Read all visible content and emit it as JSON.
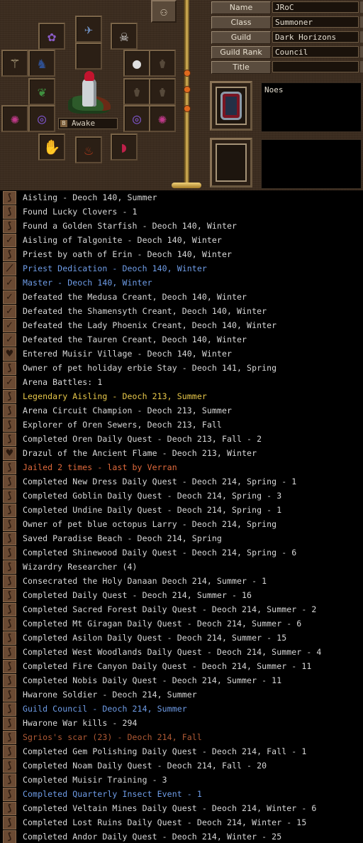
{
  "profile": {
    "fields": [
      {
        "label": "Name",
        "value": "JRoC"
      },
      {
        "label": "Class",
        "value": "Summoner"
      },
      {
        "label": "Guild",
        "value": "Dark Horizons"
      },
      {
        "label": "Guild Rank",
        "value": "Council"
      },
      {
        "label": "Title",
        "value": ""
      }
    ],
    "note_1": "Noes",
    "note_2": "",
    "status": "Awake",
    "status_number": "B"
  },
  "colors": {
    "default": "#d9d9d9",
    "blue": "#6f9de8",
    "yellow": "#e8c84a",
    "orange": "#e06a3c",
    "muted": "#b05a35"
  },
  "equipment": {
    "slots": [
      {
        "name": "earring-left-slot",
        "icon": "purple-earring-icon",
        "glyph": "✿",
        "color": "#8b5cc8"
      },
      {
        "name": "necklace-slot",
        "icon": "blue-wing-icon",
        "glyph": "✈",
        "color": "#6f8fbf"
      },
      {
        "name": "ring-right-slot",
        "icon": "skull-charm-icon",
        "glyph": "☠",
        "color": "#e0e0e0"
      },
      {
        "name": "weapon-slot",
        "icon": "staff-icon",
        "glyph": "⚚",
        "color": "#d4c49a"
      },
      {
        "name": "armor-slot",
        "icon": "blue-robe-icon",
        "glyph": "♞",
        "color": "#2f4f8f"
      },
      {
        "name": "helmet-slot",
        "icon": "empty-icon",
        "glyph": "",
        "color": "#000"
      },
      {
        "name": "overcoat-slot",
        "icon": "ghost-item-icon",
        "glyph": "⚱",
        "color": "#a89880"
      },
      {
        "name": "accessory-1-slot",
        "icon": "black-pouch-icon",
        "glyph": "●",
        "color": "#e0e0e0"
      },
      {
        "name": "accessory-2-slot",
        "icon": "ghost-item-icon",
        "glyph": "⚱",
        "color": "#a89880"
      },
      {
        "name": "cape-slot",
        "icon": "green-leaf-icon",
        "glyph": "❦",
        "color": "#3f8f3f"
      },
      {
        "name": "shield-slot",
        "icon": "ghost-item-icon",
        "glyph": "⚱",
        "color": "#a89880"
      },
      {
        "name": "gauntlet-slot",
        "icon": "ghost-item-icon",
        "glyph": "⚱",
        "color": "#a89880"
      },
      {
        "name": "hand-left-slot",
        "icon": "pink-claw-icon",
        "glyph": "✺",
        "color": "#c03a8a"
      },
      {
        "name": "bracer-left-slot",
        "icon": "purple-ring-icon",
        "glyph": "◎",
        "color": "#7b53c6"
      },
      {
        "name": "bracer-right-slot",
        "icon": "purple-ring-icon",
        "glyph": "◎",
        "color": "#7b53c6"
      },
      {
        "name": "hand-right-slot",
        "icon": "pink-claw-icon",
        "glyph": "✺",
        "color": "#c03a8a"
      },
      {
        "name": "belt-slot",
        "icon": "silver-gauntlet-icon",
        "glyph": "✋",
        "color": "#c8c8d0"
      },
      {
        "name": "boots-slot",
        "icon": "red-boots-icon",
        "glyph": "♨",
        "color": "#b03a1a"
      },
      {
        "name": "trinket-slot",
        "icon": "magenta-fan-icon",
        "glyph": "◗",
        "color": "#c0204a"
      }
    ]
  },
  "legend": [
    {
      "text": "Aisling - Deoch 140, Summer",
      "color": "default",
      "icon": "claw"
    },
    {
      "text": "Found Lucky Clovers - 1",
      "color": "default",
      "icon": "claw"
    },
    {
      "text": "Found a Golden Starfish - Deoch 140, Winter",
      "color": "default",
      "icon": "claw"
    },
    {
      "text": "Aisling of Talgonite - Deoch 140, Winter",
      "color": "default",
      "icon": "check"
    },
    {
      "text": "Priest by oath of Erin - Deoch 140, Winter",
      "color": "default",
      "icon": "claw"
    },
    {
      "text": "Priest Dedication - Deoch 140, Winter",
      "color": "blue",
      "icon": "wand"
    },
    {
      "text": "Master - Deoch 140, Winter",
      "color": "blue",
      "icon": "check"
    },
    {
      "text": "Defeated the Medusa Creant, Deoch 140, Winter",
      "color": "default",
      "icon": "check"
    },
    {
      "text": "Defeated the Shamensyth Creant, Deoch 140, Winter",
      "color": "default",
      "icon": "check"
    },
    {
      "text": "Defeated the Lady Phoenix Creant, Deoch 140, Winter",
      "color": "default",
      "icon": "check"
    },
    {
      "text": "Defeated the Tauren Creant, Deoch 140, Winter",
      "color": "default",
      "icon": "check"
    },
    {
      "text": "Entered Muisir Village - Deoch 140, Winter",
      "color": "default",
      "icon": "heart"
    },
    {
      "text": "Owner of pet holiday erbie Stay - Deoch 141, Spring",
      "color": "default",
      "icon": "claw"
    },
    {
      "text": "Arena Battles: 1",
      "color": "default",
      "icon": "check"
    },
    {
      "text": "Legendary Aisling - Deoch 213, Summer",
      "color": "yellow",
      "icon": "claw"
    },
    {
      "text": "Arena Circuit Champion - Deoch 213, Summer",
      "color": "default",
      "icon": "claw"
    },
    {
      "text": "Explorer of Oren Sewers, Deoch 213, Fall",
      "color": "default",
      "icon": "claw"
    },
    {
      "text": "Completed Oren Daily Quest - Deoch 213, Fall - 2",
      "color": "default",
      "icon": "claw"
    },
    {
      "text": "Drazul of the Ancient Flame - Deoch 213, Winter",
      "color": "default",
      "icon": "heart"
    },
    {
      "text": "Jailed 2 times - last by Verran",
      "color": "orange",
      "icon": "claw"
    },
    {
      "text": "Completed New Dress Daily Quest - Deoch 214, Spring - 1",
      "color": "default",
      "icon": "claw"
    },
    {
      "text": "Completed Goblin Daily Quest - Deoch 214, Spring - 3",
      "color": "default",
      "icon": "claw"
    },
    {
      "text": "Completed Undine Daily Quest - Deoch 214, Spring - 1",
      "color": "default",
      "icon": "claw"
    },
    {
      "text": "Owner of pet blue octopus Larry - Deoch 214, Spring",
      "color": "default",
      "icon": "claw"
    },
    {
      "text": "Saved Paradise Beach - Deoch 214, Spring",
      "color": "default",
      "icon": "claw"
    },
    {
      "text": "Completed Shinewood Daily Quest - Deoch 214, Spring - 6",
      "color": "default",
      "icon": "claw"
    },
    {
      "text": "Wizardry Researcher (4)",
      "color": "default",
      "icon": "claw"
    },
    {
      "text": "Consecrated the Holy Danaan Deoch 214, Summer - 1",
      "color": "default",
      "icon": "claw"
    },
    {
      "text": "Completed Daily Quest - Deoch 214, Summer - 16",
      "color": "default",
      "icon": "claw"
    },
    {
      "text": "Completed Sacred Forest Daily Quest - Deoch 214, Summer - 2",
      "color": "default",
      "icon": "claw"
    },
    {
      "text": "Completed Mt Giragan Daily Quest - Deoch 214, Summer - 6",
      "color": "default",
      "icon": "claw"
    },
    {
      "text": "Completed Asilon Daily Quest - Deoch 214, Summer - 15",
      "color": "default",
      "icon": "claw"
    },
    {
      "text": "Completed West Woodlands Daily Quest - Deoch 214, Summer - 4",
      "color": "default",
      "icon": "claw"
    },
    {
      "text": "Completed Fire Canyon Daily Quest - Deoch 214, Summer - 11",
      "color": "default",
      "icon": "claw"
    },
    {
      "text": "Completed Nobis Daily Quest - Deoch 214, Summer - 11",
      "color": "default",
      "icon": "claw"
    },
    {
      "text": "Hwarone Soldier - Deoch 214, Summer",
      "color": "default",
      "icon": "claw"
    },
    {
      "text": "Guild Council - Deoch 214, Summer",
      "color": "blue",
      "icon": "claw"
    },
    {
      "text": "Hwarone War kills - 294",
      "color": "default",
      "icon": "claw"
    },
    {
      "text": "Sgrios's scar (23) - Deoch 214, Fall",
      "color": "muted",
      "icon": "claw"
    },
    {
      "text": "Completed Gem Polishing Daily Quest - Deoch 214, Fall - 1",
      "color": "default",
      "icon": "claw"
    },
    {
      "text": "Completed Noam Daily Quest - Deoch 214, Fall - 20",
      "color": "default",
      "icon": "claw"
    },
    {
      "text": "Completed Muisir Training - 3",
      "color": "default",
      "icon": "claw"
    },
    {
      "text": "Completed Quarterly Insect Event - 1",
      "color": "blue",
      "icon": "claw"
    },
    {
      "text": "Completed Veltain Mines Daily Quest - Deoch 214, Winter - 6",
      "color": "default",
      "icon": "claw"
    },
    {
      "text": "Completed Lost Ruins Daily Quest - Deoch 214, Winter - 15",
      "color": "default",
      "icon": "claw"
    },
    {
      "text": "Completed Andor Daily Quest - Deoch 214, Winter - 25",
      "color": "default",
      "icon": "claw"
    }
  ]
}
